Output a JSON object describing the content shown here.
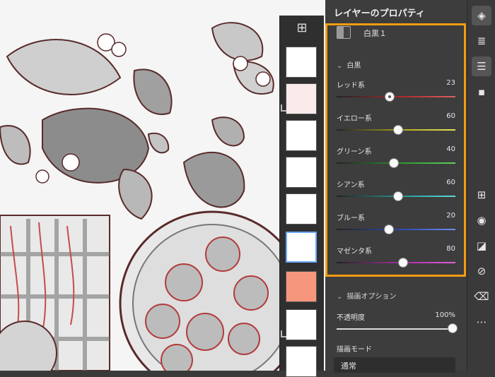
{
  "panel": {
    "title": "レイヤーのプロパティ",
    "layer_name": "白黒１"
  },
  "bw": {
    "section_title": "白黒",
    "sliders": [
      {
        "label": "レッド系",
        "value": 23,
        "gradient": "linear-gradient(90deg,#222,#b03030 60%,#e06060)"
      },
      {
        "label": "イエロー系",
        "value": 60,
        "gradient": "linear-gradient(90deg,#222,#b8b020 60%,#e6e060)"
      },
      {
        "label": "グリーン系",
        "value": 40,
        "gradient": "linear-gradient(90deg,#222,#30a030 60%,#60d060)"
      },
      {
        "label": "シアン系",
        "value": 60,
        "gradient": "linear-gradient(90deg,#222,#2aa0a0 60%,#60dada)"
      },
      {
        "label": "ブルー系",
        "value": 20,
        "gradient": "linear-gradient(90deg,#222,#3050c0 60%,#7090f0)"
      },
      {
        "label": "マゼンタ系",
        "value": 80,
        "gradient": "linear-gradient(90deg,#222,#b030b0 60%,#e060e0)"
      }
    ]
  },
  "options": {
    "section_title": "描画オプション",
    "opacity_label": "不透明度",
    "opacity_value": "100%",
    "blend_label": "描画モード",
    "blend_value": "通常"
  },
  "colors": {
    "highlight": "#f39c12",
    "panel_bg": "#3d3d3d"
  }
}
